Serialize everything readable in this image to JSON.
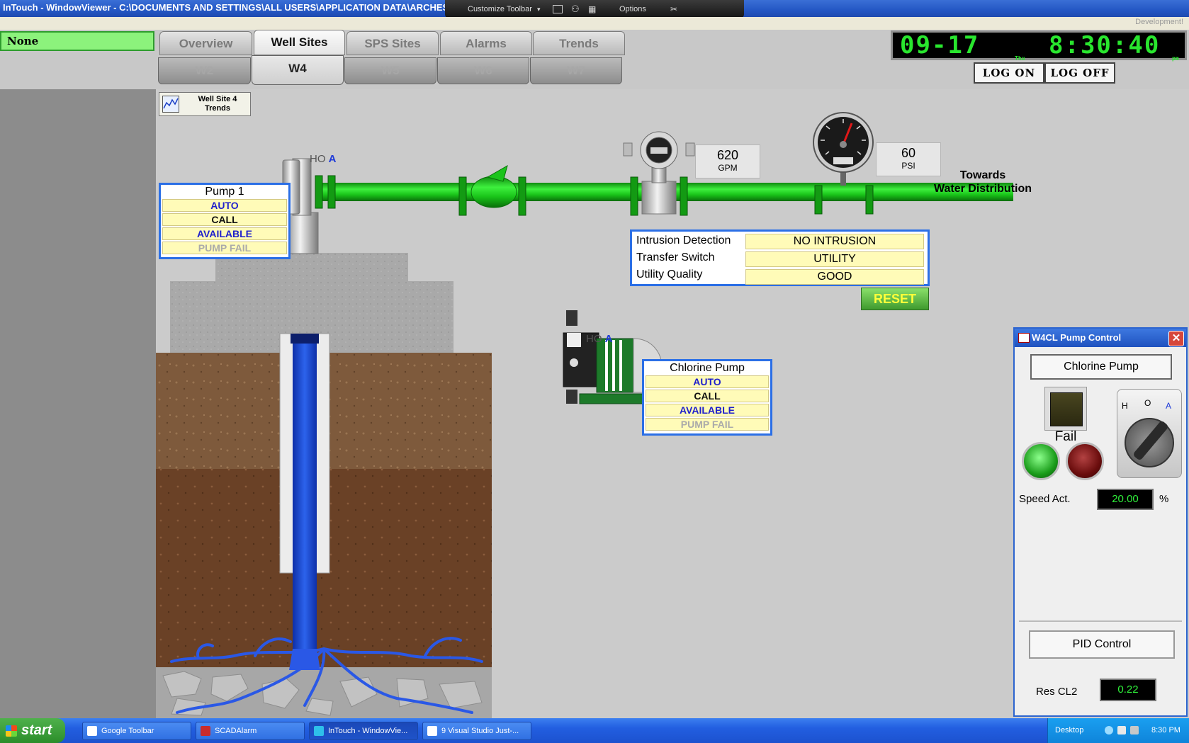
{
  "window": {
    "title": "InTouch - WindowViewer - C:\\DOCUMENTS AND SETTINGS\\ALL USERS\\APPLICATION DATA\\ARCHESTRA\\",
    "toolbar_label": "Customize Toolbar",
    "options_label": "Options",
    "dev_label": "Development!"
  },
  "left": {
    "user_label": "None"
  },
  "tabs": [
    "Overview",
    "Well Sites",
    "SPS Sites",
    "Alarms",
    "Trends"
  ],
  "active_tab": "Well Sites",
  "subtabs": [
    "W2",
    "W4",
    "W5",
    "W6",
    "W7"
  ],
  "active_subtab": "W4",
  "clock": {
    "date": "09-17",
    "day": "Thu",
    "time": "8:30:40",
    "ampm": "pm"
  },
  "login": {
    "on": "LOG ON",
    "off": "LOG OFF"
  },
  "trend_button": {
    "line1": "Well Site 4",
    "line2": "Trends"
  },
  "pump1": {
    "title": "Pump 1",
    "hoa_h": "HO",
    "hoa_a": "A",
    "status": [
      {
        "text": "AUTO",
        "color": "blue"
      },
      {
        "text": "CALL",
        "color": "black"
      },
      {
        "text": "AVAILABLE",
        "color": "blue"
      },
      {
        "text": "PUMP FAIL",
        "color": "gray"
      }
    ]
  },
  "flow": {
    "value": "620",
    "unit": "GPM"
  },
  "pressure": {
    "value": "60",
    "unit": "PSI"
  },
  "towards": {
    "line1": "Towards",
    "line2": "Water Distribution"
  },
  "intrusion": {
    "rows": [
      {
        "label": "Intrusion Detection",
        "value": "NO INTRUSION"
      },
      {
        "label": "Transfer Switch",
        "value": "UTILITY"
      },
      {
        "label": "Utility Quality",
        "value": "GOOD"
      }
    ],
    "reset_label": "RESET"
  },
  "chlorine": {
    "title": "Chlorine Pump",
    "hoa_h": "HO",
    "hoa_a": "A",
    "status": [
      {
        "text": "AUTO",
        "color": "blue"
      },
      {
        "text": "CALL",
        "color": "black"
      },
      {
        "text": "AVAILABLE",
        "color": "blue"
      },
      {
        "text": "PUMP FAIL",
        "color": "gray"
      }
    ]
  },
  "popup": {
    "title": "W4CL Pump Control",
    "header": "Chlorine Pump",
    "fail_label": "Fail",
    "switch_labels": {
      "h": "H",
      "o": "O",
      "a": "A"
    },
    "speed_label": "Speed Act.",
    "speed_value": "20.00",
    "speed_unit": "%",
    "pid_label": "PID Control",
    "res_label": "Res CL2",
    "res_value": "0.22"
  },
  "taskbar": {
    "start": "start",
    "items": [
      "Google Toolbar",
      "SCADAlarm",
      "InTouch - WindowVie...",
      "9 Visual Studio Just-..."
    ],
    "desktop": "Desktop",
    "time": "8:30 PM"
  },
  "colors": {
    "pipe": "#19c419",
    "water": "#1a4fd6",
    "accent": "#2b6fe6",
    "lcd_text": "#2fef3a"
  }
}
